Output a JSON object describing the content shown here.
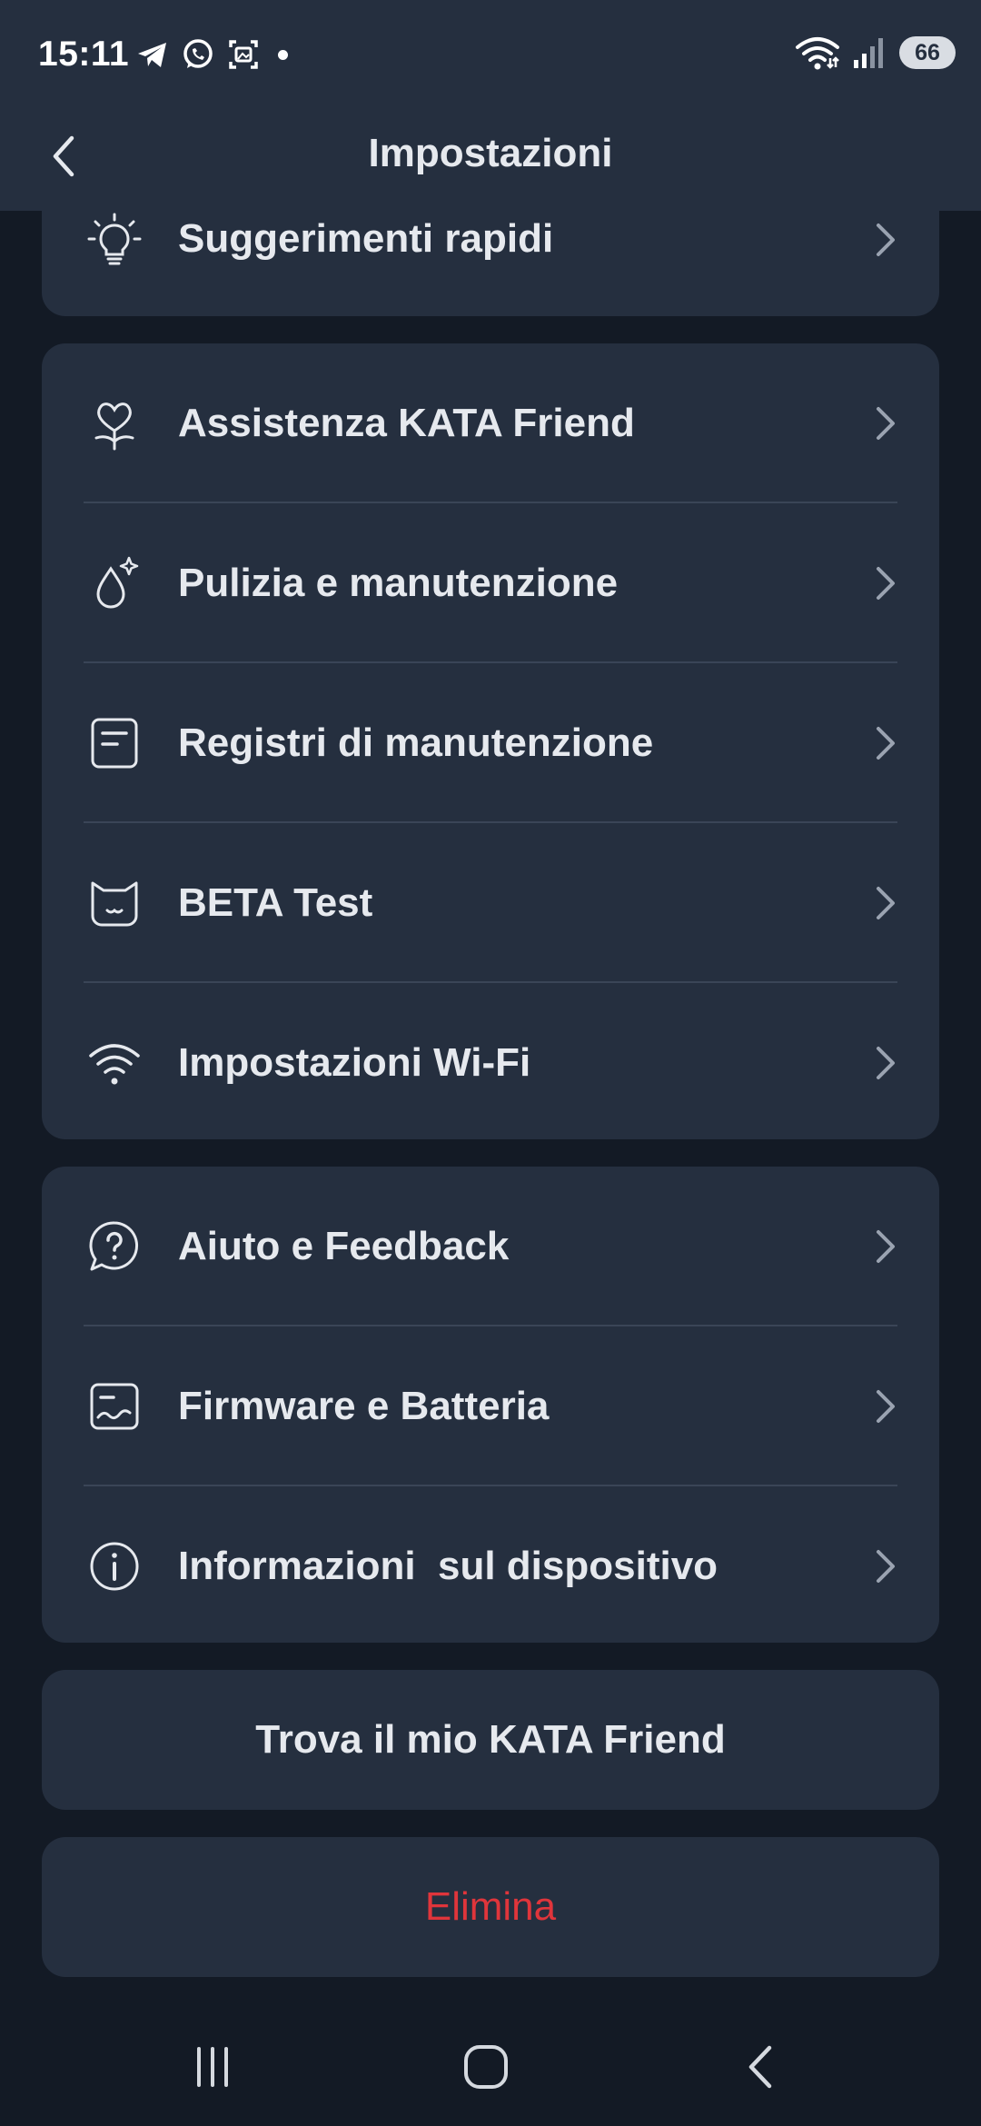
{
  "status_bar": {
    "time": "15:11",
    "battery": "66",
    "left_icons": [
      "telegram-icon",
      "whatsapp-icon",
      "screenshot-icon",
      "notification-dot"
    ],
    "right_icons": [
      "wifi-icon",
      "signal-icon",
      "battery-icon"
    ]
  },
  "header": {
    "title": "Impostazioni",
    "back_icon": "chevron-left-icon"
  },
  "card_top": {
    "items": [
      {
        "label": "Suggerimenti rapidi",
        "icon": "lightbulb-icon"
      }
    ]
  },
  "card_device": {
    "items": [
      {
        "label": "Assistenza KATA Friend",
        "icon": "heart-flower-icon"
      },
      {
        "label": "Pulizia e manutenzione",
        "icon": "drop-sparkle-icon"
      },
      {
        "label": "Registri di manutenzione",
        "icon": "document-icon"
      },
      {
        "label": "BETA Test",
        "icon": "cat-face-icon"
      },
      {
        "label": "Impostazioni Wi-Fi",
        "icon": "wifi-icon"
      }
    ]
  },
  "card_info": {
    "items": [
      {
        "label": "Aiuto e Feedback",
        "icon": "help-chat-icon"
      },
      {
        "label": "Firmware e Batteria",
        "icon": "firmware-icon"
      },
      {
        "label": "Informazioni  sul dispositivo",
        "icon": "info-icon"
      }
    ]
  },
  "actions": {
    "find_label": "Trova il mio KATA Friend",
    "delete_label": "Elimina"
  },
  "nav_bar": {
    "icons": [
      "recent-apps-icon",
      "home-icon",
      "back-icon"
    ]
  },
  "colors": {
    "background": "#131a25",
    "surface": "#252f3f",
    "text": "#e6e9ee",
    "danger": "#e0353b",
    "divider": "#3a4557"
  }
}
